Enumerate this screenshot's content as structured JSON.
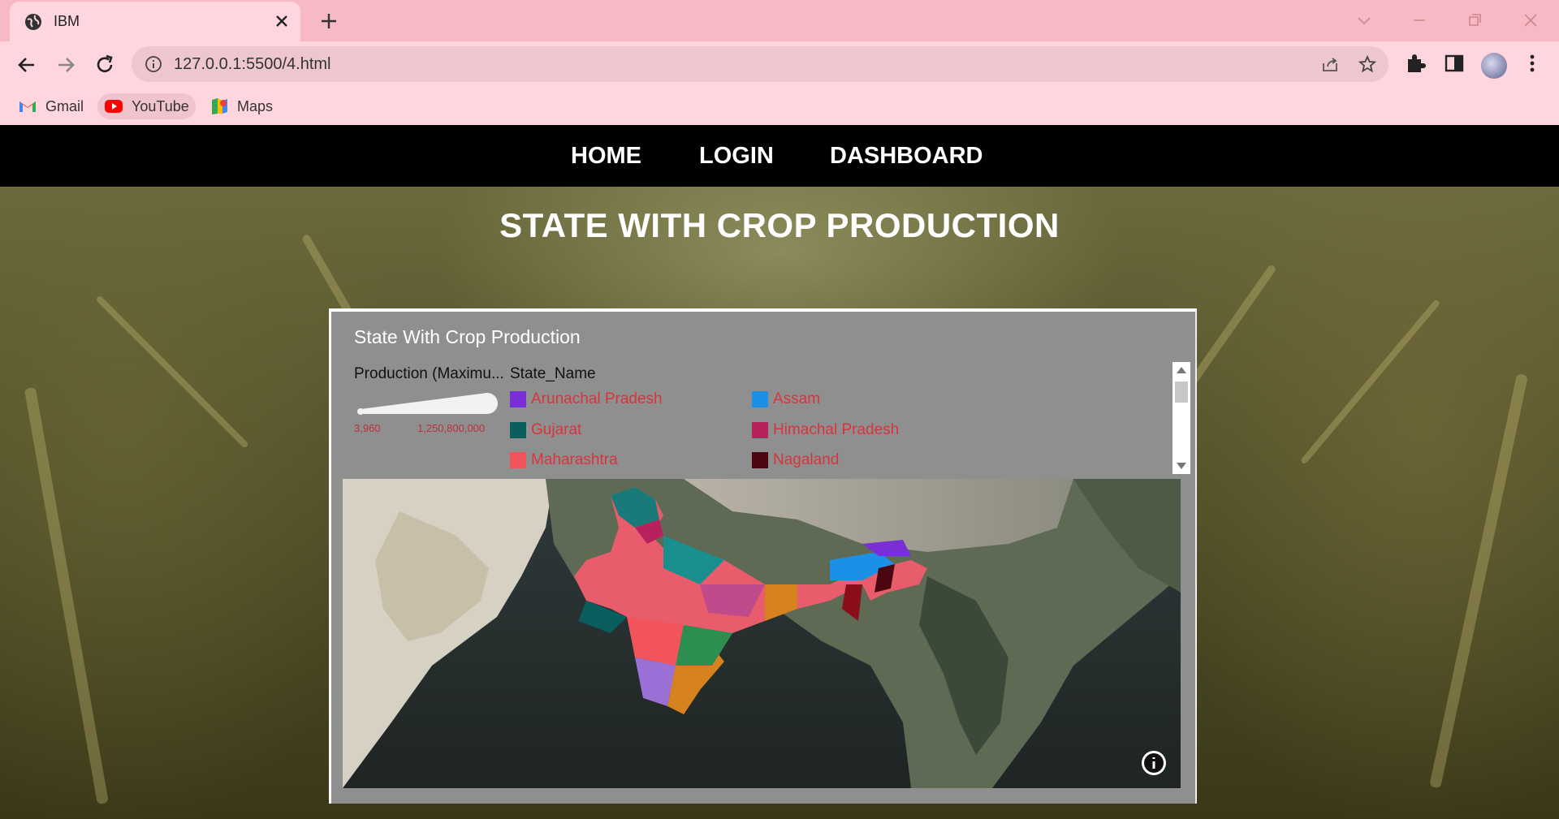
{
  "browser": {
    "tab_title": "IBM",
    "url": "127.0.0.1:5500/4.html",
    "bookmarks": [
      {
        "label": "Gmail",
        "icon": "gmail-icon"
      },
      {
        "label": "YouTube",
        "icon": "youtube-icon"
      },
      {
        "label": "Maps",
        "icon": "maps-icon"
      }
    ]
  },
  "nav": {
    "home": "HOME",
    "login": "LOGIN",
    "dashboard": "DASHBOARD"
  },
  "page_title": "STATE WITH CROP PRODUCTION",
  "viz": {
    "title": "State With Crop Production",
    "size_legend": {
      "title": "Production (Maximu...",
      "min": "3,960",
      "max": "1,250,800,000"
    },
    "color_legend": {
      "title": "State_Name",
      "items": [
        {
          "label": "Arunachal Pradesh",
          "color": "#7a2fd6"
        },
        {
          "label": "Assam",
          "color": "#1c8fe6"
        },
        {
          "label": "Gujarat",
          "color": "#0a5e5e"
        },
        {
          "label": "Himachal Pradesh",
          "color": "#b8215e"
        },
        {
          "label": "Maharashtra",
          "color": "#f2545b"
        },
        {
          "label": "Nagaland",
          "color": "#4a0710"
        }
      ]
    }
  },
  "colors": {
    "navbar": "#000000",
    "legend_text": "#d9343e",
    "tabstrip": "#f8b9c7",
    "chrome": "#ffd6de"
  }
}
